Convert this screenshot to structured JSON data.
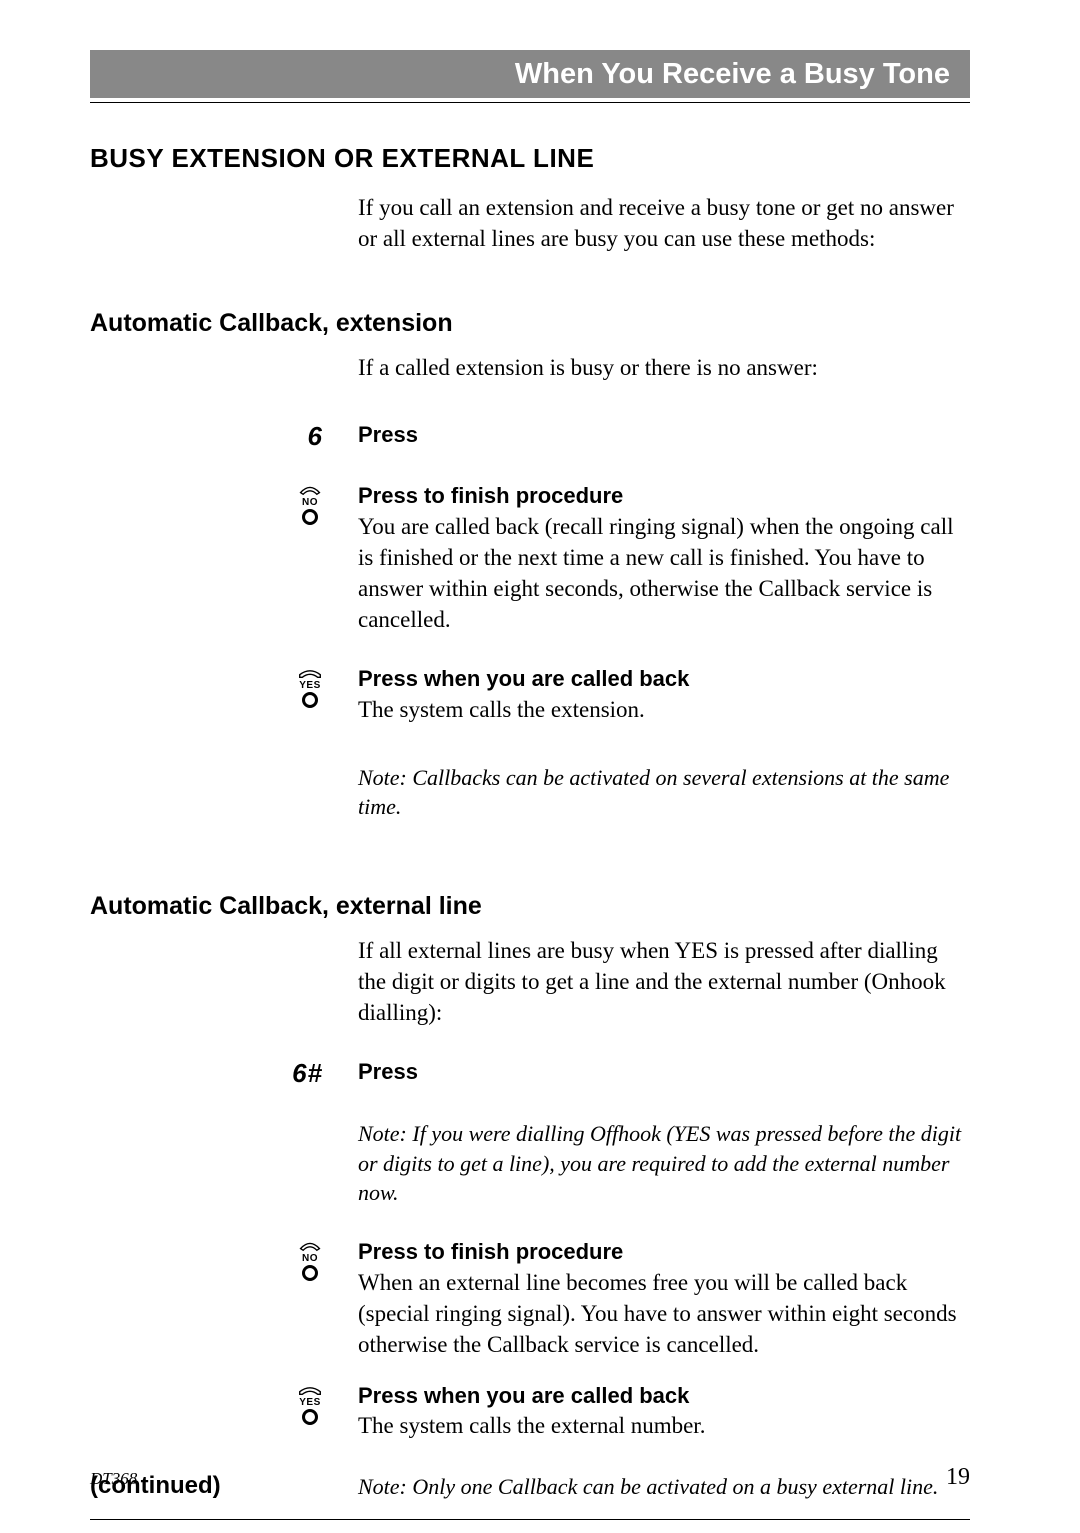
{
  "header": {
    "title": "When You Receive a Busy Tone"
  },
  "section1": {
    "heading": "BUSY EXTENSION OR EXTERNAL LINE",
    "intro": "If you call an extension and receive a busy tone or get no answer or all external lines are busy you can use these methods:"
  },
  "section2": {
    "heading": "Automatic Callback, extension",
    "intro": "If a called extension is busy or there is no answer:",
    "step1_key": "6",
    "step1_action": "Press",
    "step2_action": "Press to finish procedure",
    "step2_body": "You are called back (recall ringing signal) when the ongoing call is finished or the next time a new call is finished. You have to answer within eight seconds, otherwise the Callback service is cancelled.",
    "step3_action": "Press when you are called back",
    "step3_body": "The system calls the extension.",
    "note": "Note: Callbacks can be activated on several extensions at the same time."
  },
  "section3": {
    "heading": "Automatic Callback, external line",
    "intro": "If all external lines are busy when YES is pressed after dialling the digit or digits to get a line and the external number (Onhook dialling):",
    "step1_key": "6#",
    "step1_action": "Press",
    "note1": "Note: If you were dialling Offhook (YES was pressed before the digit or digits to get a line), you are required to add the external number now.",
    "step2_action": "Press to finish procedure",
    "step2_body": "When an external line becomes free you will be called back (special ringing signal). You have to answer within eight seconds otherwise the Callback service is cancelled.",
    "step3_action": "Press when you are called back",
    "step3_body": "The system calls the external number.",
    "note2": "Note: Only one Callback can be activated on a busy external line."
  },
  "continued": "(continued)",
  "footer": {
    "model": "DT368",
    "page_number": "19"
  },
  "icons": {
    "no_label": "NO",
    "yes_label": "YES"
  }
}
